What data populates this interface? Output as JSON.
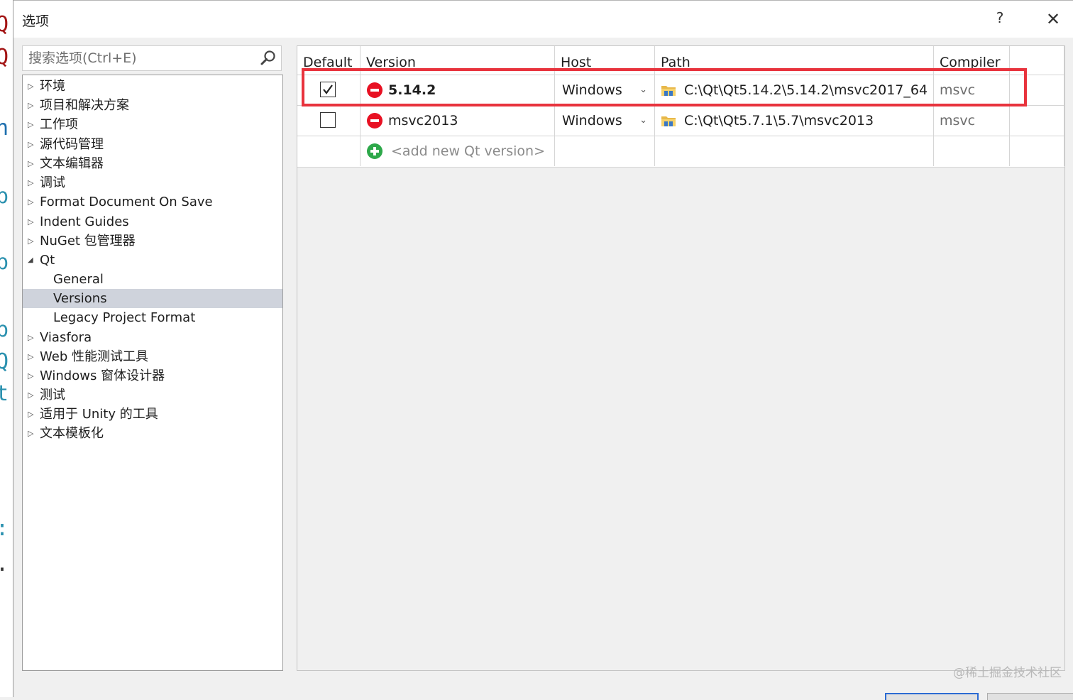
{
  "dialog": {
    "title": "选项",
    "help_label": "?",
    "close_label": "✕"
  },
  "search": {
    "placeholder": "搜索选项(Ctrl+E)"
  },
  "tree": {
    "items": [
      {
        "label": "环境",
        "arrow": "▷"
      },
      {
        "label": "项目和解决方案",
        "arrow": "▷"
      },
      {
        "label": "工作项",
        "arrow": "▷"
      },
      {
        "label": "源代码管理",
        "arrow": "▷"
      },
      {
        "label": "文本编辑器",
        "arrow": "▷"
      },
      {
        "label": "调试",
        "arrow": "▷"
      },
      {
        "label": "Format Document On Save",
        "arrow": "▷"
      },
      {
        "label": "Indent Guides",
        "arrow": "▷"
      },
      {
        "label": "NuGet 包管理器",
        "arrow": "▷"
      },
      {
        "label": "Qt",
        "arrow": "◢"
      },
      {
        "label": "General",
        "arrow": ""
      },
      {
        "label": "Versions",
        "arrow": "",
        "selected": true
      },
      {
        "label": "Legacy Project Format",
        "arrow": ""
      },
      {
        "label": "Viasfora",
        "arrow": "▷"
      },
      {
        "label": "Web 性能测试工具",
        "arrow": "▷"
      },
      {
        "label": "Windows 窗体设计器",
        "arrow": "▷"
      },
      {
        "label": "测试",
        "arrow": "▷"
      },
      {
        "label": "适用于 Unity 的工具",
        "arrow": "▷"
      },
      {
        "label": "文本模板化",
        "arrow": "▷"
      }
    ]
  },
  "grid": {
    "columns": [
      "Default",
      "Version",
      "Host",
      "Path",
      "Compiler"
    ],
    "rows": [
      {
        "default_checked": true,
        "version": "5.14.2",
        "host": "Windows",
        "path": "C:\\Qt\\Qt5.14.2\\5.14.2\\msvc2017_64",
        "compiler": "msvc"
      },
      {
        "default_checked": false,
        "version": "msvc2013",
        "host": "Windows",
        "path": "C:\\Qt\\Qt5.7.1\\5.7\\msvc2013",
        "compiler": "msvc"
      }
    ],
    "add_label": "<add new Qt version>",
    "dropdown_glyph": "⌄"
  },
  "watermark": "@稀土掘金技术社区",
  "colors": {
    "highlight": "#e8333d",
    "remove": "#e81123",
    "add": "#2da84a",
    "selection": "#cfd3dc"
  }
}
